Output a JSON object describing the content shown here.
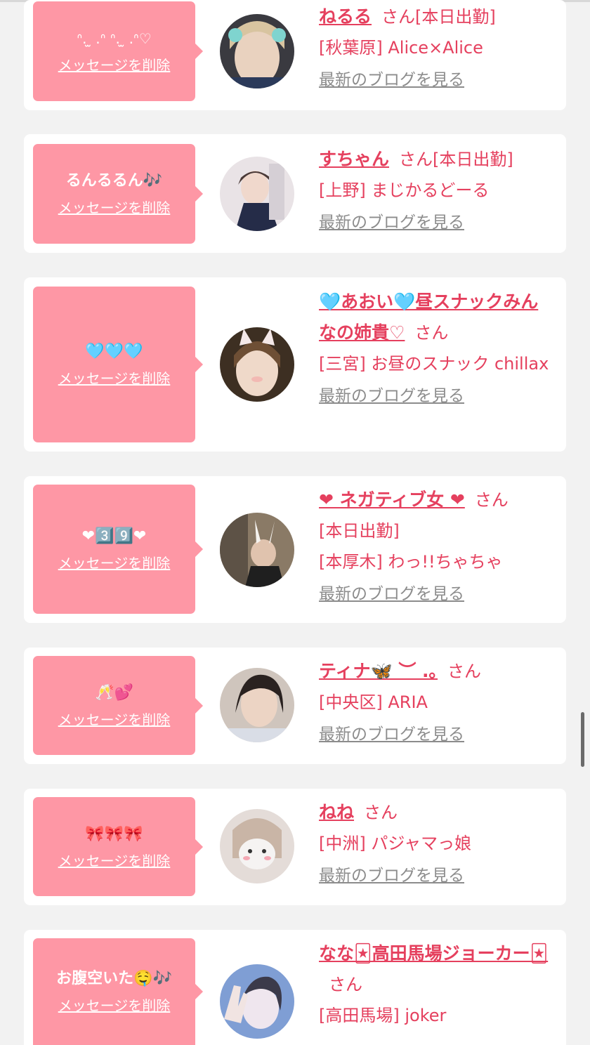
{
  "delete_label": "メッセージを削除",
  "blog_label": "最新のブログを見る",
  "san": "さん",
  "cards": [
    {
      "message": "ᐢ. ̫ .ᐢ ᐢ. ̫ .ᐢ♡",
      "name": "ねるる",
      "shift": "[本日出勤]",
      "area_shop": "[秋葉原] Alice×Alice"
    },
    {
      "message": "るんるるん🎶",
      "name": "すちゃん",
      "shift": "[本日出勤]",
      "area_shop": "[上野] まじかるどーる"
    },
    {
      "message": "🩵🩵🩵",
      "name": "🩵あおい🩵昼スナックみんなの姉貴♡",
      "shift": "",
      "area_shop": "[三宮] お昼のスナック chillax"
    },
    {
      "message": "❤︎3️⃣9️⃣❤︎",
      "name": "❤ ネガティブ女 ❤",
      "shift": "[本日出勤]",
      "area_shop": "[本厚木] わっ!!ちゃちゃ"
    },
    {
      "message": "🥂💕",
      "name": "ティナ🦋 ︶ .｡",
      "shift": "",
      "area_shop": "[中央区] ARIA"
    },
    {
      "message": "🎀🎀🎀",
      "name": "ねね",
      "shift": "",
      "area_shop": "[中洲] パジャマっ娘"
    },
    {
      "message": "お腹空いた🤤🎶",
      "name": "なな🃏高田馬場ジョーカー🃏",
      "shift": "",
      "area_shop": "[高田馬場] joker"
    }
  ],
  "colors": {
    "accent": "#e5405e",
    "bubble": "#fe97a5",
    "background": "#f2f2f2",
    "link_gray": "#8c8c8c"
  }
}
